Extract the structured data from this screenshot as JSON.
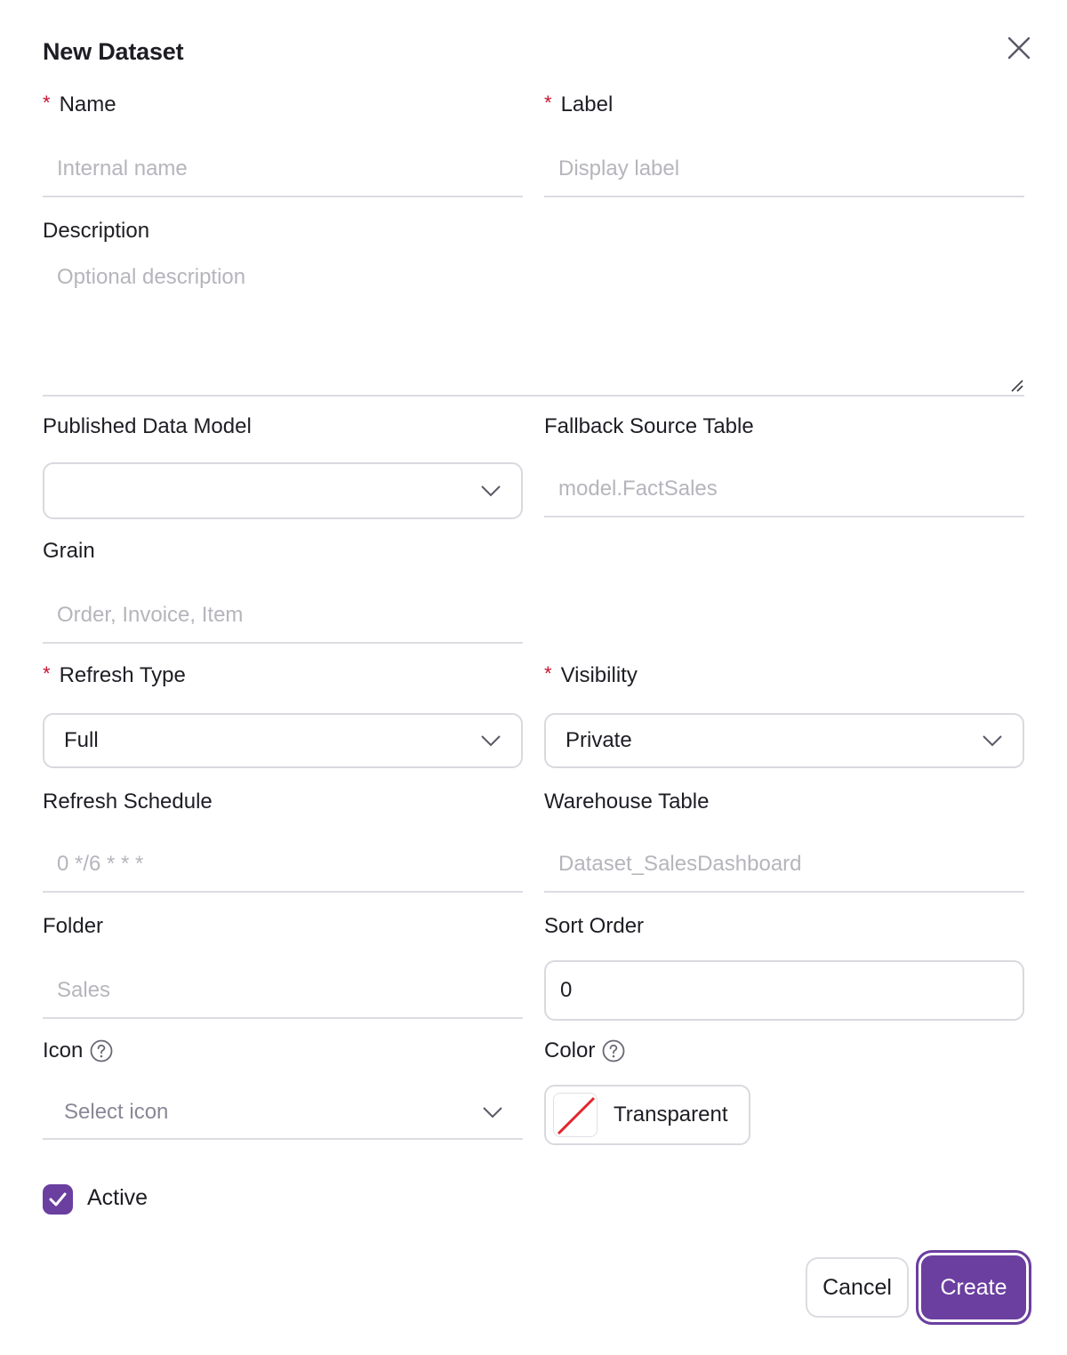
{
  "dialog": {
    "title": "New Dataset"
  },
  "fields": {
    "name": {
      "label": "Name",
      "required_mark": "*",
      "placeholder": "Internal name"
    },
    "label": {
      "label": "Label",
      "required_mark": "*",
      "placeholder": "Display label"
    },
    "description": {
      "label": "Description",
      "placeholder": "Optional description"
    },
    "published_data_model": {
      "label": "Published Data Model",
      "value": ""
    },
    "fallback_source_table": {
      "label": "Fallback Source Table",
      "placeholder": "model.FactSales"
    },
    "grain": {
      "label": "Grain",
      "placeholder": "Order, Invoice, Item"
    },
    "refresh_type": {
      "label": "Refresh Type",
      "required_mark": "*",
      "value": "Full"
    },
    "visibility": {
      "label": "Visibility",
      "required_mark": "*",
      "value": "Private"
    },
    "refresh_schedule": {
      "label": "Refresh Schedule",
      "placeholder": "0 */6 * * *"
    },
    "warehouse_table": {
      "label": "Warehouse Table",
      "placeholder": "Dataset_SalesDashboard"
    },
    "folder": {
      "label": "Folder",
      "placeholder": "Sales"
    },
    "sort_order": {
      "label": "Sort Order",
      "value": "0"
    },
    "icon": {
      "label": "Icon",
      "placeholder": "Select icon",
      "help_icon": "question-circle-icon"
    },
    "color": {
      "label": "Color",
      "value": "Transparent",
      "help_icon": "question-circle-icon"
    },
    "active": {
      "label": "Active",
      "checked": true
    }
  },
  "actions": {
    "cancel": "Cancel",
    "create": "Create"
  },
  "colors": {
    "accent": "#6b3fa0",
    "required": "#c8102e",
    "placeholder": "#b5b5bc",
    "border": "#dcdce2"
  }
}
